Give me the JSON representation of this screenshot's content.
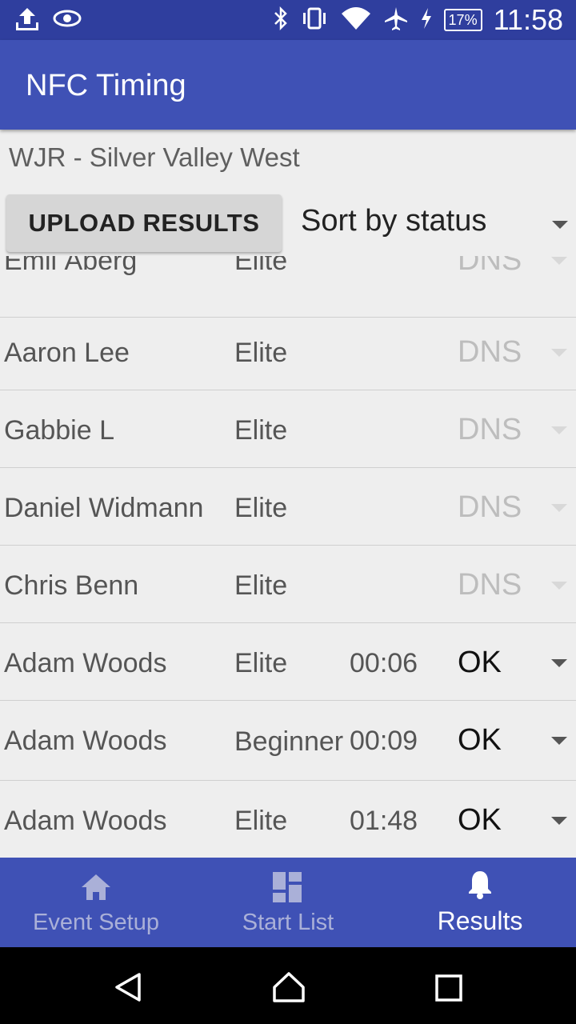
{
  "status_bar": {
    "time": "11:58",
    "battery": "17%",
    "icons_left": [
      "upload-icon",
      "eye-icon"
    ],
    "icons_right": [
      "bluetooth-icon",
      "vibrate-icon",
      "wifi-icon",
      "airplane-icon",
      "charging-icon",
      "battery-icon"
    ]
  },
  "app_bar": {
    "title": "NFC Timing",
    "color": "#3f51b5"
  },
  "event": {
    "name": "WJR - Silver Valley West"
  },
  "toolbar": {
    "upload_label": "UPLOAD RESULTS",
    "sort_value": "Sort by status"
  },
  "results": [
    {
      "name": "Emil Åberg",
      "class": "Elite",
      "time": "",
      "status": "DNS"
    },
    {
      "name": "Aaron Lee",
      "class": "Elite",
      "time": "",
      "status": "DNS"
    },
    {
      "name": "Gabbie L",
      "class": "Elite",
      "time": "",
      "status": "DNS"
    },
    {
      "name": "Daniel Widmann",
      "class": "Elite",
      "time": "",
      "status": "DNS"
    },
    {
      "name": "Chris Benn",
      "class": "Elite",
      "time": "",
      "status": "DNS"
    },
    {
      "name": "Adam Woods",
      "class": "Elite",
      "time": "00:06",
      "status": "OK"
    },
    {
      "name": "Adam Woods",
      "class": "Beginner",
      "time": "00:09",
      "status": "OK"
    },
    {
      "name": "Adam Woods",
      "class": "Elite",
      "time": "01:48",
      "status": "OK"
    }
  ],
  "bottom_nav": {
    "items": [
      {
        "label": "Event Setup",
        "icon": "home-icon",
        "active": false
      },
      {
        "label": "Start List",
        "icon": "dashboard-icon",
        "active": false
      },
      {
        "label": "Results",
        "icon": "bell-icon",
        "active": true
      }
    ]
  },
  "system_nav": {
    "icons": [
      "back-icon",
      "home-icon",
      "recents-icon"
    ]
  }
}
